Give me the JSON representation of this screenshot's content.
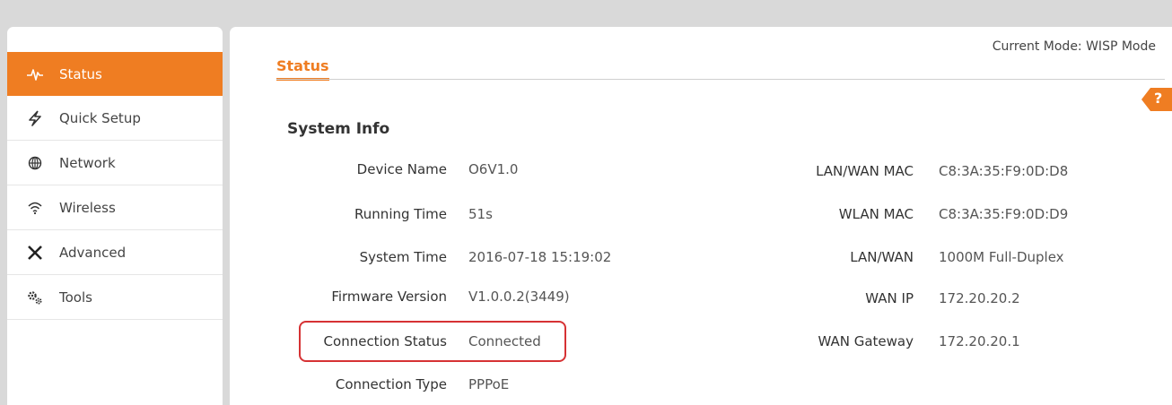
{
  "sidebar": {
    "items": [
      {
        "label": "Status",
        "icon": "pulse-icon"
      },
      {
        "label": "Quick Setup",
        "icon": "lightning-icon"
      },
      {
        "label": "Network",
        "icon": "globe-icon"
      },
      {
        "label": "Wireless",
        "icon": "wifi-icon"
      },
      {
        "label": "Advanced",
        "icon": "tools-cross-icon"
      },
      {
        "label": "Tools",
        "icon": "gears-icon"
      }
    ],
    "active_index": 0
  },
  "header": {
    "mode": "Current Mode: WISP Mode",
    "tab": "Status",
    "help": "?"
  },
  "section": {
    "title": "System Info"
  },
  "left_info": [
    {
      "label": "Device Name",
      "value": "O6V1.0"
    },
    {
      "label": "Running Time",
      "value": "51s"
    },
    {
      "label": "System Time",
      "value": "2016-07-18 15:19:02"
    },
    {
      "label": "Firmware Version",
      "value": "V1.0.0.2(3449)"
    },
    {
      "label": "Connection Status",
      "value": "Connected"
    },
    {
      "label": "Connection Type",
      "value": "PPPoE"
    }
  ],
  "right_info": [
    {
      "label": "LAN/WAN MAC",
      "value": "C8:3A:35:F9:0D:D8"
    },
    {
      "label": "WLAN MAC",
      "value": "C8:3A:35:F9:0D:D9"
    },
    {
      "label": "LAN/WAN",
      "value": "1000M Full-Duplex"
    },
    {
      "label": "WAN IP",
      "value": "172.20.20.2"
    },
    {
      "label": "WAN Gateway",
      "value": "172.20.20.1"
    }
  ],
  "colors": {
    "accent": "#ef7d22",
    "highlight": "#d63234"
  }
}
